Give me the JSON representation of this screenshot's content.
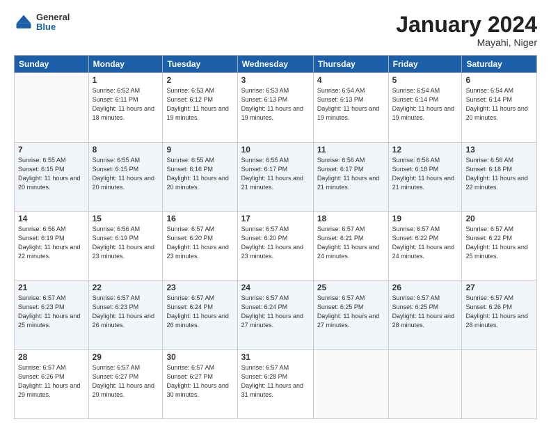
{
  "header": {
    "logo_general": "General",
    "logo_blue": "Blue",
    "month_title": "January 2024",
    "location": "Mayahi, Niger"
  },
  "weekdays": [
    "Sunday",
    "Monday",
    "Tuesday",
    "Wednesday",
    "Thursday",
    "Friday",
    "Saturday"
  ],
  "weeks": [
    [
      {
        "day": "",
        "sunrise": "",
        "sunset": "",
        "daylight": ""
      },
      {
        "day": "1",
        "sunrise": "Sunrise: 6:52 AM",
        "sunset": "Sunset: 6:11 PM",
        "daylight": "Daylight: 11 hours and 18 minutes."
      },
      {
        "day": "2",
        "sunrise": "Sunrise: 6:53 AM",
        "sunset": "Sunset: 6:12 PM",
        "daylight": "Daylight: 11 hours and 19 minutes."
      },
      {
        "day": "3",
        "sunrise": "Sunrise: 6:53 AM",
        "sunset": "Sunset: 6:13 PM",
        "daylight": "Daylight: 11 hours and 19 minutes."
      },
      {
        "day": "4",
        "sunrise": "Sunrise: 6:54 AM",
        "sunset": "Sunset: 6:13 PM",
        "daylight": "Daylight: 11 hours and 19 minutes."
      },
      {
        "day": "5",
        "sunrise": "Sunrise: 6:54 AM",
        "sunset": "Sunset: 6:14 PM",
        "daylight": "Daylight: 11 hours and 19 minutes."
      },
      {
        "day": "6",
        "sunrise": "Sunrise: 6:54 AM",
        "sunset": "Sunset: 6:14 PM",
        "daylight": "Daylight: 11 hours and 20 minutes."
      }
    ],
    [
      {
        "day": "7",
        "sunrise": "Sunrise: 6:55 AM",
        "sunset": "Sunset: 6:15 PM",
        "daylight": "Daylight: 11 hours and 20 minutes."
      },
      {
        "day": "8",
        "sunrise": "Sunrise: 6:55 AM",
        "sunset": "Sunset: 6:15 PM",
        "daylight": "Daylight: 11 hours and 20 minutes."
      },
      {
        "day": "9",
        "sunrise": "Sunrise: 6:55 AM",
        "sunset": "Sunset: 6:16 PM",
        "daylight": "Daylight: 11 hours and 20 minutes."
      },
      {
        "day": "10",
        "sunrise": "Sunrise: 6:55 AM",
        "sunset": "Sunset: 6:17 PM",
        "daylight": "Daylight: 11 hours and 21 minutes."
      },
      {
        "day": "11",
        "sunrise": "Sunrise: 6:56 AM",
        "sunset": "Sunset: 6:17 PM",
        "daylight": "Daylight: 11 hours and 21 minutes."
      },
      {
        "day": "12",
        "sunrise": "Sunrise: 6:56 AM",
        "sunset": "Sunset: 6:18 PM",
        "daylight": "Daylight: 11 hours and 21 minutes."
      },
      {
        "day": "13",
        "sunrise": "Sunrise: 6:56 AM",
        "sunset": "Sunset: 6:18 PM",
        "daylight": "Daylight: 11 hours and 22 minutes."
      }
    ],
    [
      {
        "day": "14",
        "sunrise": "Sunrise: 6:56 AM",
        "sunset": "Sunset: 6:19 PM",
        "daylight": "Daylight: 11 hours and 22 minutes."
      },
      {
        "day": "15",
        "sunrise": "Sunrise: 6:56 AM",
        "sunset": "Sunset: 6:19 PM",
        "daylight": "Daylight: 11 hours and 23 minutes."
      },
      {
        "day": "16",
        "sunrise": "Sunrise: 6:57 AM",
        "sunset": "Sunset: 6:20 PM",
        "daylight": "Daylight: 11 hours and 23 minutes."
      },
      {
        "day": "17",
        "sunrise": "Sunrise: 6:57 AM",
        "sunset": "Sunset: 6:20 PM",
        "daylight": "Daylight: 11 hours and 23 minutes."
      },
      {
        "day": "18",
        "sunrise": "Sunrise: 6:57 AM",
        "sunset": "Sunset: 6:21 PM",
        "daylight": "Daylight: 11 hours and 24 minutes."
      },
      {
        "day": "19",
        "sunrise": "Sunrise: 6:57 AM",
        "sunset": "Sunset: 6:22 PM",
        "daylight": "Daylight: 11 hours and 24 minutes."
      },
      {
        "day": "20",
        "sunrise": "Sunrise: 6:57 AM",
        "sunset": "Sunset: 6:22 PM",
        "daylight": "Daylight: 11 hours and 25 minutes."
      }
    ],
    [
      {
        "day": "21",
        "sunrise": "Sunrise: 6:57 AM",
        "sunset": "Sunset: 6:23 PM",
        "daylight": "Daylight: 11 hours and 25 minutes."
      },
      {
        "day": "22",
        "sunrise": "Sunrise: 6:57 AM",
        "sunset": "Sunset: 6:23 PM",
        "daylight": "Daylight: 11 hours and 26 minutes."
      },
      {
        "day": "23",
        "sunrise": "Sunrise: 6:57 AM",
        "sunset": "Sunset: 6:24 PM",
        "daylight": "Daylight: 11 hours and 26 minutes."
      },
      {
        "day": "24",
        "sunrise": "Sunrise: 6:57 AM",
        "sunset": "Sunset: 6:24 PM",
        "daylight": "Daylight: 11 hours and 27 minutes."
      },
      {
        "day": "25",
        "sunrise": "Sunrise: 6:57 AM",
        "sunset": "Sunset: 6:25 PM",
        "daylight": "Daylight: 11 hours and 27 minutes."
      },
      {
        "day": "26",
        "sunrise": "Sunrise: 6:57 AM",
        "sunset": "Sunset: 6:25 PM",
        "daylight": "Daylight: 11 hours and 28 minutes."
      },
      {
        "day": "27",
        "sunrise": "Sunrise: 6:57 AM",
        "sunset": "Sunset: 6:26 PM",
        "daylight": "Daylight: 11 hours and 28 minutes."
      }
    ],
    [
      {
        "day": "28",
        "sunrise": "Sunrise: 6:57 AM",
        "sunset": "Sunset: 6:26 PM",
        "daylight": "Daylight: 11 hours and 29 minutes."
      },
      {
        "day": "29",
        "sunrise": "Sunrise: 6:57 AM",
        "sunset": "Sunset: 6:27 PM",
        "daylight": "Daylight: 11 hours and 29 minutes."
      },
      {
        "day": "30",
        "sunrise": "Sunrise: 6:57 AM",
        "sunset": "Sunset: 6:27 PM",
        "daylight": "Daylight: 11 hours and 30 minutes."
      },
      {
        "day": "31",
        "sunrise": "Sunrise: 6:57 AM",
        "sunset": "Sunset: 6:28 PM",
        "daylight": "Daylight: 11 hours and 31 minutes."
      },
      {
        "day": "",
        "sunrise": "",
        "sunset": "",
        "daylight": ""
      },
      {
        "day": "",
        "sunrise": "",
        "sunset": "",
        "daylight": ""
      },
      {
        "day": "",
        "sunrise": "",
        "sunset": "",
        "daylight": ""
      }
    ]
  ]
}
